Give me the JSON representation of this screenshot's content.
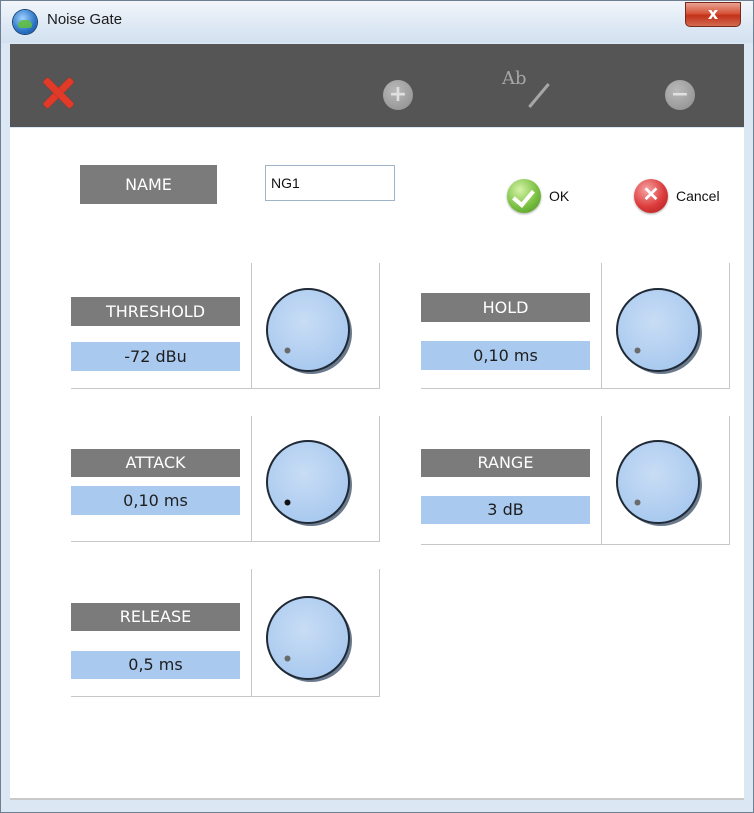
{
  "window": {
    "title": "Noise Gate",
    "close_glyph": "x"
  },
  "toolbar": {
    "delete_icon": "red-x-icon",
    "add_icon": "plus-circle-icon",
    "add_glyph": "+",
    "rename_icon": "rename-ab-icon",
    "rename_glyph": "Ab",
    "remove_icon": "minus-circle-icon",
    "remove_glyph": "−"
  },
  "form": {
    "name_label": "NAME",
    "name_value": "NG1",
    "ok_label": "OK",
    "cancel_label": "Cancel",
    "cancel_glyph": "✕"
  },
  "params": [
    {
      "label": "THRESHOLD",
      "value": "-72 dBu",
      "knob_level": 0.0
    },
    {
      "label": "HOLD",
      "value": "0,10 ms",
      "knob_level": 0.0
    },
    {
      "label": "ATTACK",
      "value": "0,10 ms",
      "knob_level": 0.0
    },
    {
      "label": "RANGE",
      "value": "3 dB",
      "knob_level": 0.0
    },
    {
      "label": "RELEASE",
      "value": "0,5 ms",
      "knob_level": 0.0
    }
  ],
  "colors": {
    "toolbar_bg": "#555555",
    "label_bg": "#7b7b7b",
    "value_bg": "#a9c9ef",
    "knob_fill": "#a9c9ef"
  }
}
